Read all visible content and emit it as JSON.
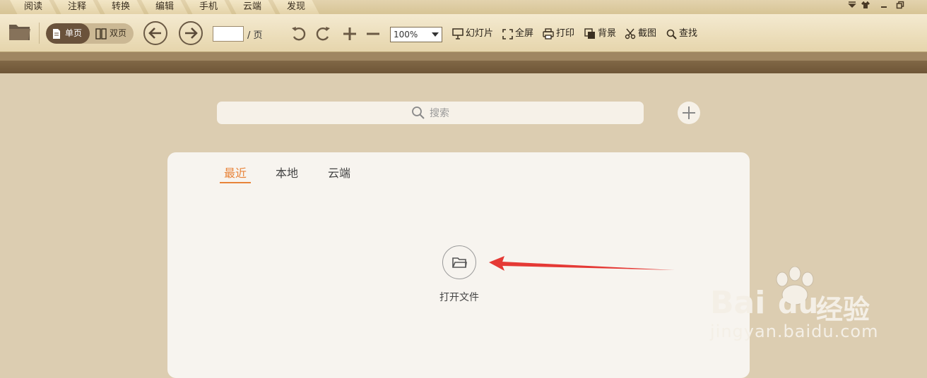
{
  "menu": [
    "阅读",
    "注释",
    "转换",
    "编辑",
    "手机",
    "云端",
    "发现"
  ],
  "window_controls": [
    "dropdown-icon",
    "skin-icon",
    "minimize-icon",
    "restore-icon"
  ],
  "toolbar": {
    "single_page": "单页",
    "double_page": "双页",
    "page_suffix": "/ 页",
    "page_value": "",
    "zoom": "100%",
    "slideshow": "幻灯片",
    "fullscreen": "全屏",
    "print": "打印",
    "background": "背景",
    "screenshot": "截图",
    "find": "查找"
  },
  "search": {
    "placeholder": "搜索"
  },
  "tabs": [
    "最近",
    "本地",
    "云端"
  ],
  "active_tab": "最近",
  "open_file": "打开文件",
  "watermark": {
    "brand": "Bai",
    "brand2": "du",
    "product": "经验",
    "url": "jingyan.baidu.com"
  },
  "colors": {
    "accent": "#e8843a",
    "arrow": "#e53935",
    "toolbar": "#efe2c0",
    "band": "#7a6040"
  }
}
